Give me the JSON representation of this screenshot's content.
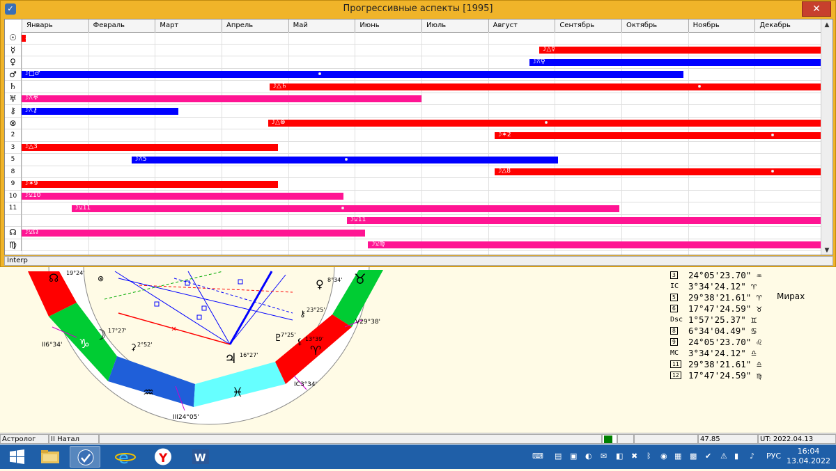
{
  "window": {
    "title": "Прогрессивные аспекты [1995]",
    "close_glyph": "✕",
    "status": "Interp"
  },
  "months": [
    "Январь",
    "Февраль",
    "Март",
    "Апрель",
    "Май",
    "Июнь",
    "Июль",
    "Август",
    "Сентябрь",
    "Октябрь",
    "Ноябрь",
    "Декабрь"
  ],
  "rows": [
    {
      "planet": "☉",
      "bar": {
        "start": 0.0,
        "end": 0.05,
        "color": "#ff0000",
        "label": "☽☌",
        "dot": null
      }
    },
    {
      "planet": "☿",
      "bar": {
        "start": 7.77,
        "end": 12.0,
        "color": "#ff0000",
        "label": "☽△☿",
        "dot": null
      }
    },
    {
      "planet": "♀",
      "bar": {
        "start": 7.62,
        "end": 12.0,
        "color": "#0000ff",
        "label": "☽⚻♀",
        "dot": null
      }
    },
    {
      "planet": "♂",
      "bar": {
        "start": 0.0,
        "end": 9.93,
        "color": "#0000ff",
        "label": "☽□♂",
        "dot": 4.45
      }
    },
    {
      "planet": "♄",
      "bar": {
        "start": 3.72,
        "end": 12.0,
        "color": "#ff0000",
        "label": "☽△♄",
        "dot": 10.15
      }
    },
    {
      "planet": "♅",
      "bar": {
        "start": 0.0,
        "end": 6.0,
        "color": "#ff1493",
        "label": "☽⚻♅",
        "dot": null
      }
    },
    {
      "planet": "⚷",
      "bar": {
        "start": 0.0,
        "end": 2.35,
        "color": "#0000ff",
        "label": "☽⚻⚷",
        "dot": null
      }
    },
    {
      "planet": "⊗",
      "bar": {
        "start": 3.7,
        "end": 12.0,
        "color": "#ff0000",
        "label": "☽△⊗",
        "dot": 7.85
      }
    },
    {
      "planet": "2",
      "bar": {
        "start": 7.1,
        "end": 12.0,
        "color": "#ff0000",
        "label": "☽✶2",
        "dot": 11.25
      }
    },
    {
      "planet": "3",
      "bar": {
        "start": 0.0,
        "end": 3.85,
        "color": "#ff0000",
        "label": "☽△3",
        "dot": null
      }
    },
    {
      "planet": "5",
      "bar": {
        "start": 1.65,
        "end": 8.05,
        "color": "#0000ff",
        "label": "☽⚻5",
        "dot": 4.85
      }
    },
    {
      "planet": "8",
      "bar": {
        "start": 7.1,
        "end": 12.0,
        "color": "#ff0000",
        "label": "☽△8",
        "dot": 11.25
      }
    },
    {
      "planet": "9",
      "bar": {
        "start": 0.0,
        "end": 3.85,
        "color": "#ff0000",
        "label": "☽✶9",
        "dot": null
      }
    },
    {
      "planet": "10",
      "bar": {
        "start": 0.0,
        "end": 4.83,
        "color": "#ff1493",
        "label": "☽⚺10",
        "dot": null
      }
    },
    {
      "planet": "11",
      "bar": {
        "start": 0.75,
        "end": 8.97,
        "color": "#ff1493",
        "label": "☽⚺11",
        "dot": 4.8
      }
    },
    {
      "planet": "",
      "bar": {
        "start": 4.88,
        "end": 12.0,
        "color": "#ff1493",
        "label": "☽⚺11",
        "dot": null
      }
    },
    {
      "planet": "☊",
      "bar": {
        "start": 0.0,
        "end": 5.15,
        "color": "#ff1493",
        "label": "☽⚺☊",
        "dot": null
      }
    },
    {
      "planet": "♍",
      "bar": {
        "start": 5.2,
        "end": 12.0,
        "color": "#ff1493",
        "label": "☽⚺♍",
        "dot": null
      }
    }
  ],
  "chart_labels": {
    "node_top": "☊19°24'",
    "venus_top": "♀8°34'",
    "taurus": "♉",
    "chiron_a": "⚷23°25'",
    "v_right": "V29°38'",
    "pluto": "♇7°25'",
    "vesta": "⚸13°39'",
    "house2": "II6°34'",
    "moon": "☽17°27'",
    "capricorn": "♑",
    "ceres": "⚳2°52'",
    "jupiter": "♃16°27'",
    "aries": "♈",
    "ic": "IC3°34'",
    "aquarius": "♒",
    "pisces": "♓",
    "house3": "III24°05'"
  },
  "positions": [
    {
      "h": "3",
      "val": "24°05'23.70\" ♒"
    },
    {
      "h": "IC",
      "val": "3°34'24.12\" ♈"
    },
    {
      "h": "5",
      "val": "29°38'21.61\" ♈"
    },
    {
      "h": "6",
      "val": "17°47'24.59\" ♉"
    },
    {
      "h": "Dsc",
      "val": "1°57'25.37\" ♊"
    },
    {
      "h": "8",
      "val": "6°34'04.49\" ♋"
    },
    {
      "h": "9",
      "val": "24°05'23.70\" ♌"
    },
    {
      "h": "MC",
      "val": "3°34'24.12\" ♎"
    },
    {
      "h": "11",
      "val": "29°38'21.61\" ♎"
    },
    {
      "h": "12",
      "val": "17°47'24.59\" ♍"
    }
  ],
  "mirah": "Мирах",
  "statusbar": {
    "app": "Астролог",
    "chart": "II Натал",
    "value": "47.85",
    "ut": "UT: 2022.04.13 13:04:32"
  },
  "taskbar": {
    "lang": "РУС",
    "time": "16:04",
    "date": "13.04.2022"
  }
}
